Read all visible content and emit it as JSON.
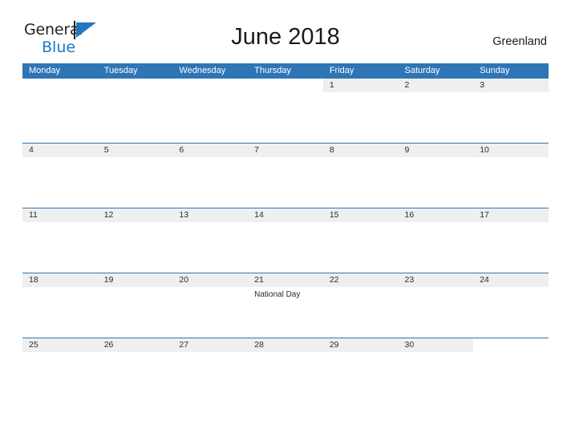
{
  "brand": {
    "name_part1": "General",
    "name_part2": "Blue",
    "flag_icon": "blue-flag-triangle",
    "accent_color": "#1f78c1"
  },
  "header": {
    "title": "June 2018",
    "location": "Greenland"
  },
  "colors": {
    "header_blue": "#2e75b6",
    "row_band_gray": "#efefef",
    "text": "#2b2b2b",
    "page_background": "#ffffff"
  },
  "calendar": {
    "month": "June",
    "year": "2018",
    "weekday_headers": [
      "Monday",
      "Tuesday",
      "Wednesday",
      "Thursday",
      "Friday",
      "Saturday",
      "Sunday"
    ],
    "weeks": [
      [
        {
          "day": "",
          "events": []
        },
        {
          "day": "",
          "events": []
        },
        {
          "day": "",
          "events": []
        },
        {
          "day": "",
          "events": []
        },
        {
          "day": "1",
          "events": []
        },
        {
          "day": "2",
          "events": []
        },
        {
          "day": "3",
          "events": []
        }
      ],
      [
        {
          "day": "4",
          "events": []
        },
        {
          "day": "5",
          "events": []
        },
        {
          "day": "6",
          "events": []
        },
        {
          "day": "7",
          "events": []
        },
        {
          "day": "8",
          "events": []
        },
        {
          "day": "9",
          "events": []
        },
        {
          "day": "10",
          "events": []
        }
      ],
      [
        {
          "day": "11",
          "events": []
        },
        {
          "day": "12",
          "events": []
        },
        {
          "day": "13",
          "events": []
        },
        {
          "day": "14",
          "events": []
        },
        {
          "day": "15",
          "events": []
        },
        {
          "day": "16",
          "events": []
        },
        {
          "day": "17",
          "events": []
        }
      ],
      [
        {
          "day": "18",
          "events": []
        },
        {
          "day": "19",
          "events": []
        },
        {
          "day": "20",
          "events": []
        },
        {
          "day": "21",
          "events": [
            "National Day"
          ]
        },
        {
          "day": "22",
          "events": []
        },
        {
          "day": "23",
          "events": []
        },
        {
          "day": "24",
          "events": []
        }
      ],
      [
        {
          "day": "25",
          "events": []
        },
        {
          "day": "26",
          "events": []
        },
        {
          "day": "27",
          "events": []
        },
        {
          "day": "28",
          "events": []
        },
        {
          "day": "29",
          "events": []
        },
        {
          "day": "30",
          "events": []
        },
        {
          "day": "",
          "events": []
        }
      ]
    ]
  }
}
